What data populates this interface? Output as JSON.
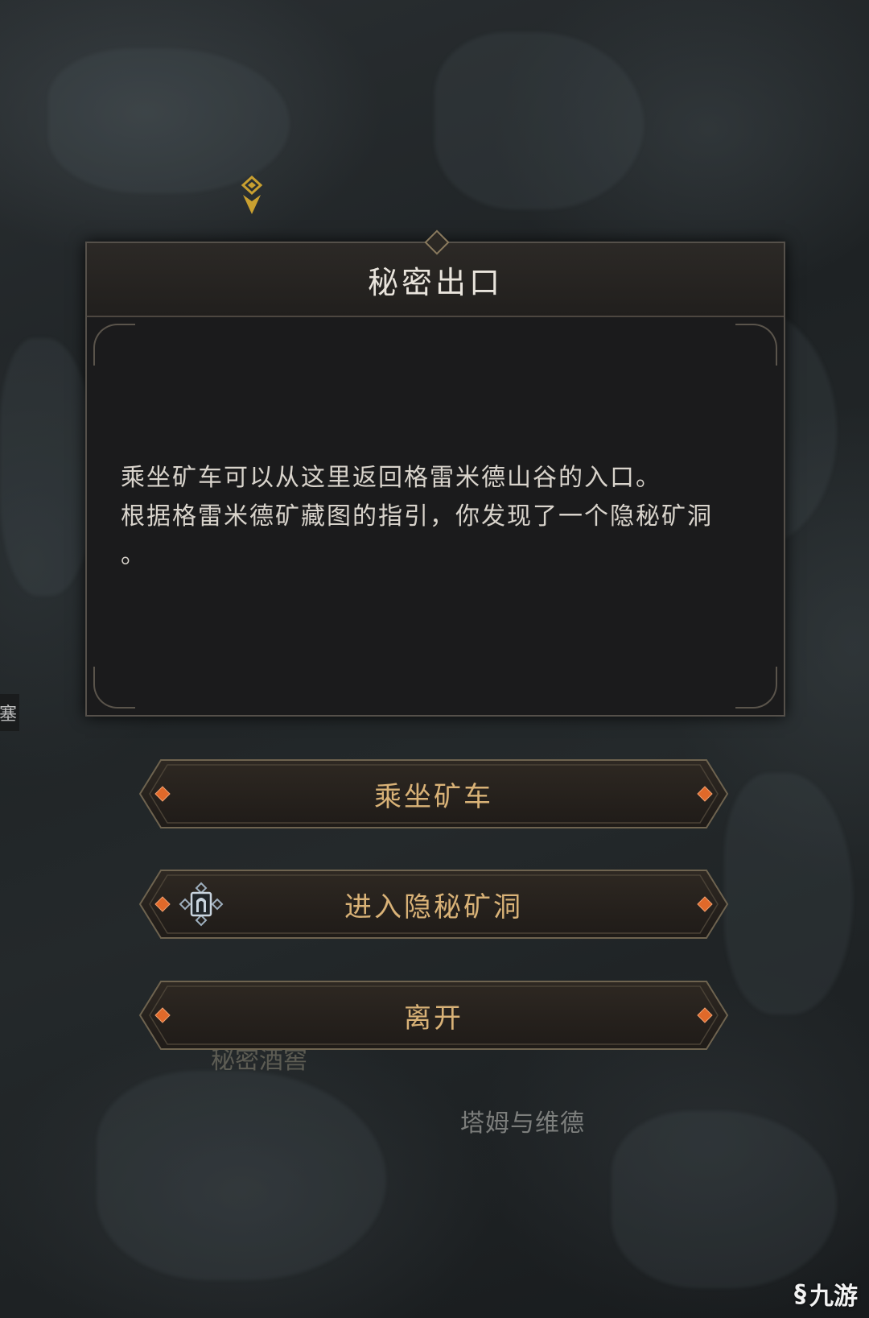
{
  "dialog": {
    "title": "秘密出口",
    "body_line1": "乘坐矿车可以从这里返回格雷米德山谷的入口。",
    "body_line2": "根据格雷米德矿藏图的指引，你发现了一个隐秘矿洞",
    "body_line3": "。"
  },
  "options": [
    {
      "label": "乘坐矿车",
      "icon": "none"
    },
    {
      "label": "进入隐秘矿洞",
      "icon": "dungeon-gate-icon"
    },
    {
      "label": "离开",
      "icon": "none"
    }
  ],
  "map": {
    "location_label": "塔姆与维德",
    "partial_label": "秘密酒窖",
    "edge_label": "塞"
  },
  "watermark": {
    "text": "九游",
    "logo_glyph": "§"
  },
  "colors": {
    "button_text": "#d9b277",
    "gem_orange": "#e0692a",
    "frame_gold": "#8a7a5e",
    "dialog_bg": "#1b1b1c"
  }
}
